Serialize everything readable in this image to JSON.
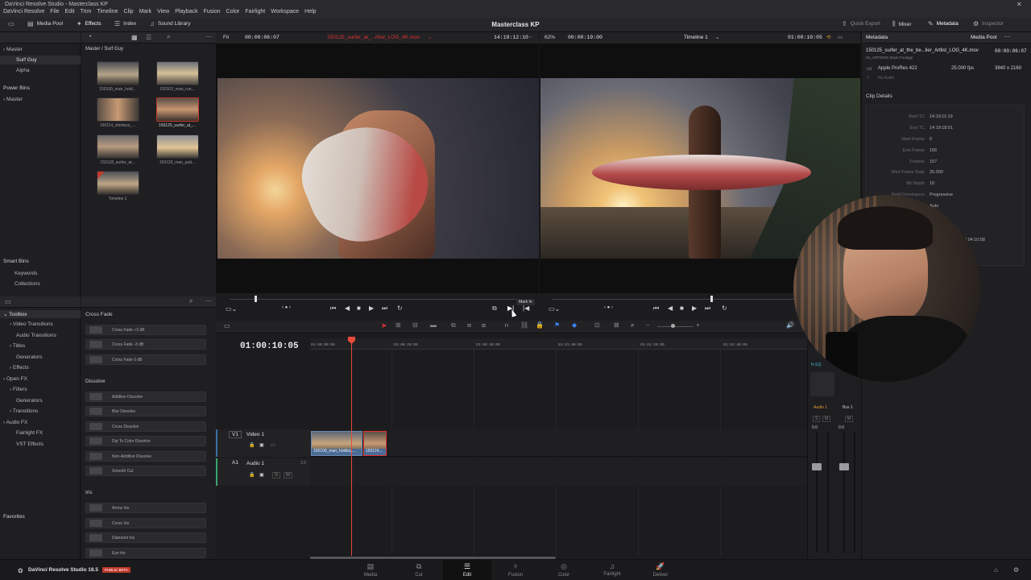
{
  "window": {
    "title": "DaVinci Resolve Studio - Masterclass KP",
    "close": "✕"
  },
  "menu": [
    "DaVinci Resolve",
    "File",
    "Edit",
    "Trim",
    "Timeline",
    "Clip",
    "Mark",
    "View",
    "Playback",
    "Fusion",
    "Color",
    "Fairlight",
    "Workspace",
    "Help"
  ],
  "toolbar": {
    "media_pool": "Media Pool",
    "effects": "Effects",
    "index": "Index",
    "sound_library": "Sound Library",
    "project_title": "Masterclass KP",
    "quick_export": "Quick Export",
    "mixer": "Mixer",
    "metadata": "Metadata",
    "inspector": "Inspector"
  },
  "source_viewer": {
    "fit": "Fit",
    "duration": "00:00:06:07",
    "clip_name": "150125_surfer_at_...rtlist_LOG_4K.mov",
    "timecode": "14:19:12:10"
  },
  "timeline_viewer": {
    "zoom": "62%",
    "duration": "00:00:19:00",
    "timeline_name": "Timeline 1",
    "timecode": "01:00:10:05"
  },
  "tooltip": "Mark In",
  "bins": {
    "master": "Master",
    "surf_guy": "Surf Guy",
    "alpha": "Alpha",
    "power_bins": "Power Bins",
    "power_master": "Master",
    "smart_bins": "Smart Bins",
    "keywords": "Keywords",
    "collections": "Collections",
    "favorites": "Favorites"
  },
  "pool": {
    "path": "Master / Surf Guy",
    "clips": [
      {
        "name": "150100_man_hold..."
      },
      {
        "name": "150103_man_run..."
      },
      {
        "name": "150114_shirtless_..."
      },
      {
        "name": "150125_surfer_at_..."
      },
      {
        "name": "150128_surfer_at..."
      },
      {
        "name": "150129_man_putt..."
      },
      {
        "name": "Timeline 1"
      }
    ]
  },
  "toolbox": {
    "items": [
      "Toolbox",
      "Video Transitions",
      "Audio Transitions",
      "Titles",
      "Generators",
      "Effects",
      "Open FX",
      "Filters",
      "Generators",
      "Transitions",
      "Audio FX",
      "Fairlight FX",
      "VST Effects"
    ]
  },
  "effects": {
    "cross_fade_hdr": "Cross Fade",
    "cross_fade": [
      "Cross Fade +3 dB",
      "Cross Fade -3 dB",
      "Cross Fade 0 dB"
    ],
    "dissolve_hdr": "Dissolve",
    "dissolve": [
      "Additive Dissolve",
      "Blur Dissolve",
      "Cross Dissolve",
      "Dip To Color Dissolve",
      "Non-Additive Dissolve",
      "Smooth Cut"
    ],
    "iris_hdr": "Iris",
    "iris": [
      "Arrow Iris",
      "Cross Iris",
      "Diamond Iris",
      "Eye Iris"
    ]
  },
  "timeline": {
    "timecode": "01:00:10:05",
    "ruler": [
      "01:00:00:00",
      "01:00:20:00",
      "01:00:40:00",
      "01:01:00:00",
      "01:01:20:00",
      "01:01:40:00"
    ],
    "video_track": {
      "id": "V1",
      "name": "Video 1"
    },
    "audio_track": {
      "id": "A1",
      "name": "Audio 1",
      "ch": "2.0"
    },
    "clips": [
      {
        "name": "150100_man_holding..."
      },
      {
        "name": "150114..."
      }
    ]
  },
  "mixer": {
    "audio1": "Audio 1",
    "bus1": "Bus 1",
    "val1": "0.0",
    "val2": "0.0"
  },
  "metadata_panel": {
    "header": "Metadata",
    "media_pool": "Media Pool",
    "file": "150125_surfer_at_the_be...lier_Artlist_LOG_4K.mov",
    "duration": "00:00:06:07",
    "source": "S1_ARTGRID Stock Footage",
    "codec": "Apple ProRes 422",
    "fps": "25.000 fps",
    "res": "3840 x 2160",
    "no_audio": "No Audio",
    "clip_details": "Clip Details",
    "rows": [
      {
        "k": "Start TC",
        "v": "14:19:11:19"
      },
      {
        "k": "End TC",
        "v": "14:19:18:01"
      },
      {
        "k": "Start Frame",
        "v": "0"
      },
      {
        "k": "End Frame",
        "v": "156"
      },
      {
        "k": "Frames",
        "v": "157"
      },
      {
        "k": "Shot Frame Rate",
        "v": "25.000"
      },
      {
        "k": "Bit Depth",
        "v": "10"
      },
      {
        "k": "Field Dominance",
        "v": "Progressive"
      },
      {
        "k": "",
        "v": "Auto"
      }
    ],
    "date_frag": "2 04:10:58"
  },
  "pages": [
    "Media",
    "Cut",
    "Edit",
    "Fusion",
    "Color",
    "Fairlight",
    "Deliver"
  ],
  "branding": {
    "name": "DaVinci Resolve Studio 18.5",
    "badge": "PUBLIC BETA"
  },
  "colors": {
    "accent_red": "#e2322e",
    "playhead": "#e84a3c",
    "selection": "#c0392b"
  }
}
